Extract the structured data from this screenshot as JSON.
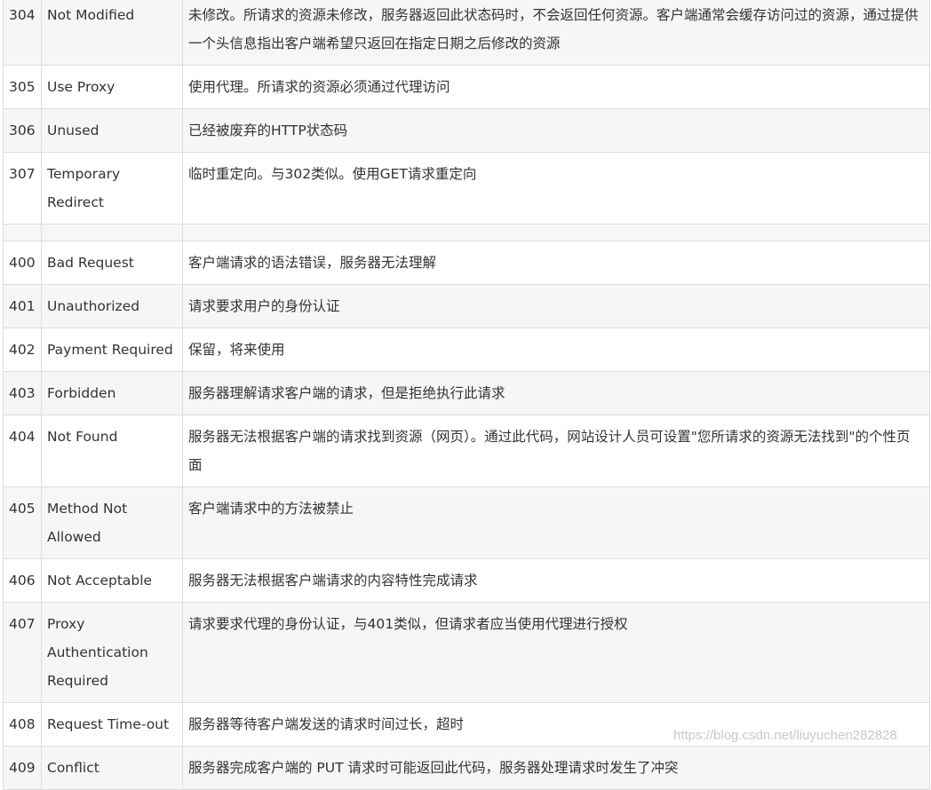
{
  "rows": [
    {
      "code": "304",
      "name": "Not Modified",
      "desc": "未修改。所请求的资源未修改，服务器返回此状态码时，不会返回任何资源。客户端通常会缓存访问过的资源，通过提供一个头信息指出客户端希望只返回在指定日期之后修改的资源"
    },
    {
      "code": "305",
      "name": "Use Proxy",
      "desc": "使用代理。所请求的资源必须通过代理访问"
    },
    {
      "code": "306",
      "name": "Unused",
      "desc": "已经被废弃的HTTP状态码"
    },
    {
      "code": "307",
      "name": "Temporary Redirect",
      "desc": "临时重定向。与302类似。使用GET请求重定向"
    },
    {
      "code": "",
      "name": "",
      "desc": ""
    },
    {
      "code": "400",
      "name": "Bad Request",
      "desc": "客户端请求的语法错误，服务器无法理解"
    },
    {
      "code": "401",
      "name": "Unauthorized",
      "desc": "请求要求用户的身份认证"
    },
    {
      "code": "402",
      "name": "Payment Required",
      "desc": "保留，将来使用"
    },
    {
      "code": "403",
      "name": "Forbidden",
      "desc": "服务器理解请求客户端的请求，但是拒绝执行此请求"
    },
    {
      "code": "404",
      "name": "Not Found",
      "desc": "服务器无法根据客户端的请求找到资源（网页）。通过此代码，网站设计人员可设置\"您所请求的资源无法找到\"的个性页面"
    },
    {
      "code": "405",
      "name": "Method Not Allowed",
      "desc": "客户端请求中的方法被禁止"
    },
    {
      "code": "406",
      "name": "Not Acceptable",
      "desc": "服务器无法根据客户端请求的内容特性完成请求"
    },
    {
      "code": "407",
      "name": "Proxy Authentication Required",
      "desc": "请求要求代理的身份认证，与401类似，但请求者应当使用代理进行授权"
    },
    {
      "code": "408",
      "name": "Request Time-out",
      "desc": "服务器等待客户端发送的请求时间过长，超时"
    },
    {
      "code": "409",
      "name": "Conflict",
      "desc": "服务器完成客户端的 PUT 请求时可能返回此代码，服务器处理请求时发生了冲突"
    }
  ],
  "watermark": "https://blog.csdn.net/liuyuchen282828"
}
